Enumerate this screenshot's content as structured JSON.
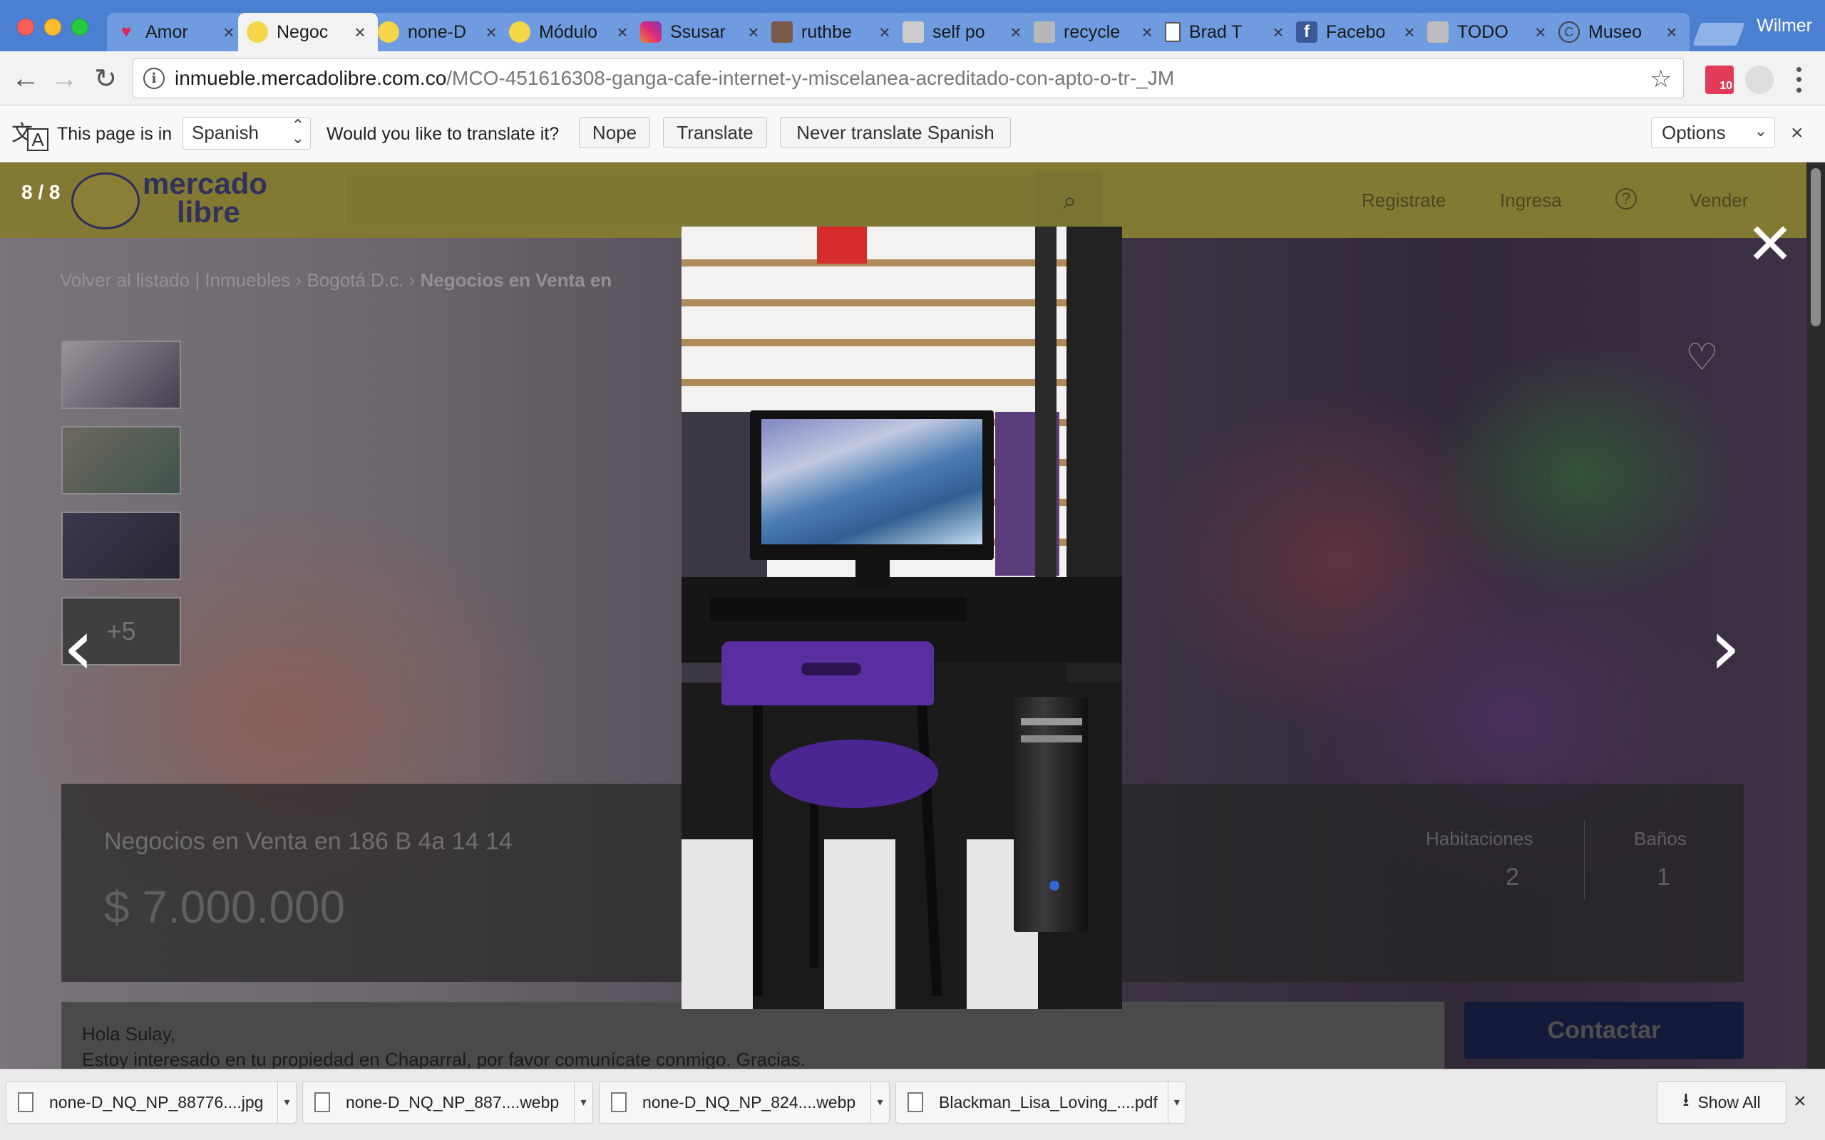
{
  "browser": {
    "profile_name": "Wilmer",
    "tabs": [
      {
        "title": "Amor",
        "icon": "heart-icon",
        "close": "×"
      },
      {
        "title": "Negoc",
        "icon": "mercadolibre-icon",
        "close": "×"
      },
      {
        "title": "none-D",
        "icon": "mercadolibre-icon",
        "close": "×"
      },
      {
        "title": "Módulo",
        "icon": "mercadolibre-icon",
        "close": "×"
      },
      {
        "title": "Ssusar",
        "icon": "instagram-icon",
        "close": "×"
      },
      {
        "title": "ruthbe",
        "icon": "photo-icon",
        "close": "×"
      },
      {
        "title": "self po",
        "icon": "image-icon",
        "close": "×"
      },
      {
        "title": "recycle",
        "icon": "image-icon",
        "close": "×"
      },
      {
        "title": "Brad T",
        "icon": "document-icon",
        "close": "×"
      },
      {
        "title": "Facebo",
        "icon": "facebook-icon",
        "close": "×"
      },
      {
        "title": "TODO",
        "icon": "image-icon",
        "close": "×"
      },
      {
        "title": "Museo",
        "icon": "copyright-icon",
        "close": "×"
      }
    ],
    "url_host": "inmueble.mercadolibre.com.co",
    "url_path": "/MCO-451616308-ganga-cafe-internet-y-miscelanea-acreditado-con-apto-o-tr-_JM",
    "ext_badge": "10"
  },
  "translate_bar": {
    "prefix": "This page is in",
    "language": "Spanish",
    "question": "Would you like to translate it?",
    "nope": "Nope",
    "translate": "Translate",
    "never": "Never translate Spanish",
    "options": "Options"
  },
  "site": {
    "logo_line1": "mercado",
    "logo_line2": "libre",
    "nav": [
      "Registrate",
      "Ingresa",
      "?",
      "Vender"
    ],
    "breadcrumb": [
      "Volver al listado",
      "Inmuebles",
      "Bogotá D.c.",
      "Negocios en Venta en"
    ],
    "breadcrumb_sep": "|",
    "breadcrumb_arrow": "›",
    "thumb_more": "+5",
    "listing": {
      "title": "Negocios en Venta en 186 B 4a 14 14",
      "price": "$ 7.000.000",
      "rooms_label": "Habitaciones",
      "rooms_value": "2",
      "baths_label": "Baños",
      "baths_value": "1"
    },
    "message_line1": "Hola Sulay,",
    "message_line2": "Estoy interesado en tu propiedad en Chaparral, por favor comunícate conmigo. Gracias.",
    "contact_label": "Contactar"
  },
  "lightbox": {
    "counter": "8 / 8",
    "close_symbol": "✕",
    "prev_symbol": "‹",
    "next_symbol": "›"
  },
  "downloads": {
    "items": [
      {
        "name": "none-D_NQ_NP_88776....jpg"
      },
      {
        "name": "none-D_NQ_NP_887....webp"
      },
      {
        "name": "none-D_NQ_NP_824....webp"
      },
      {
        "name": "Blackman_Lisa_Loving_....pdf"
      }
    ],
    "show_all": "Show All",
    "close": "×"
  },
  "colors": {
    "tabbar": "#4a7fd1",
    "mercadolibre_yellow": "#aea33c",
    "contact_button": "#141a3a",
    "chair": "#5a2ea0"
  }
}
